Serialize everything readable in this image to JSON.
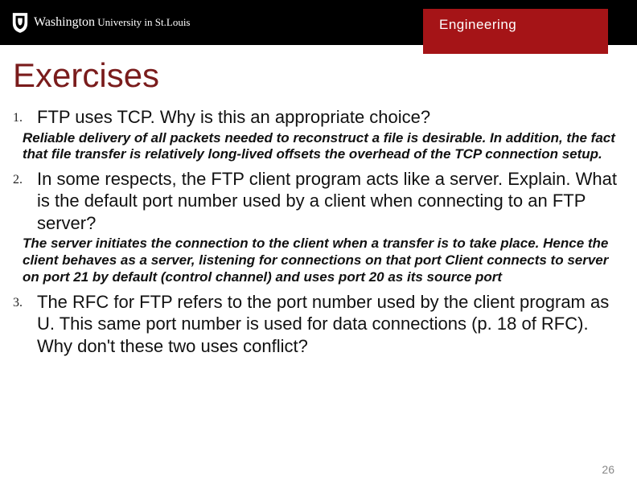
{
  "header": {
    "institution_html": "WashingtonUniversity in St.Louis",
    "engineering_label": "Engineering"
  },
  "title": "Exercises",
  "items": [
    {
      "num": "1.",
      "question": "FTP uses TCP. Why is this an appropriate choice?",
      "answer": "Reliable delivery of all packets needed to reconstruct a file is desirable.  In addition, the fact that file transfer is relatively long-lived offsets the overhead of the TCP connection setup."
    },
    {
      "num": "2.",
      "question": "In some respects, the FTP client program acts like a server. Explain. What is the default port number used by a client when connecting to an FTP server?",
      "answer": "The server initiates the connection to the client when a transfer is to take place. Hence the client behaves as a server, listening for connections on that port Client connects to server on port 21 by default (control channel) and uses port 20 as its source port"
    },
    {
      "num": "3.",
      "question": "The RFC for FTP refers to the port number used by the client program as U. This same port number is used for data connections (p. 18 of RFC). Why don't these two uses conflict?",
      "answer": ""
    }
  ],
  "page_number": "26"
}
